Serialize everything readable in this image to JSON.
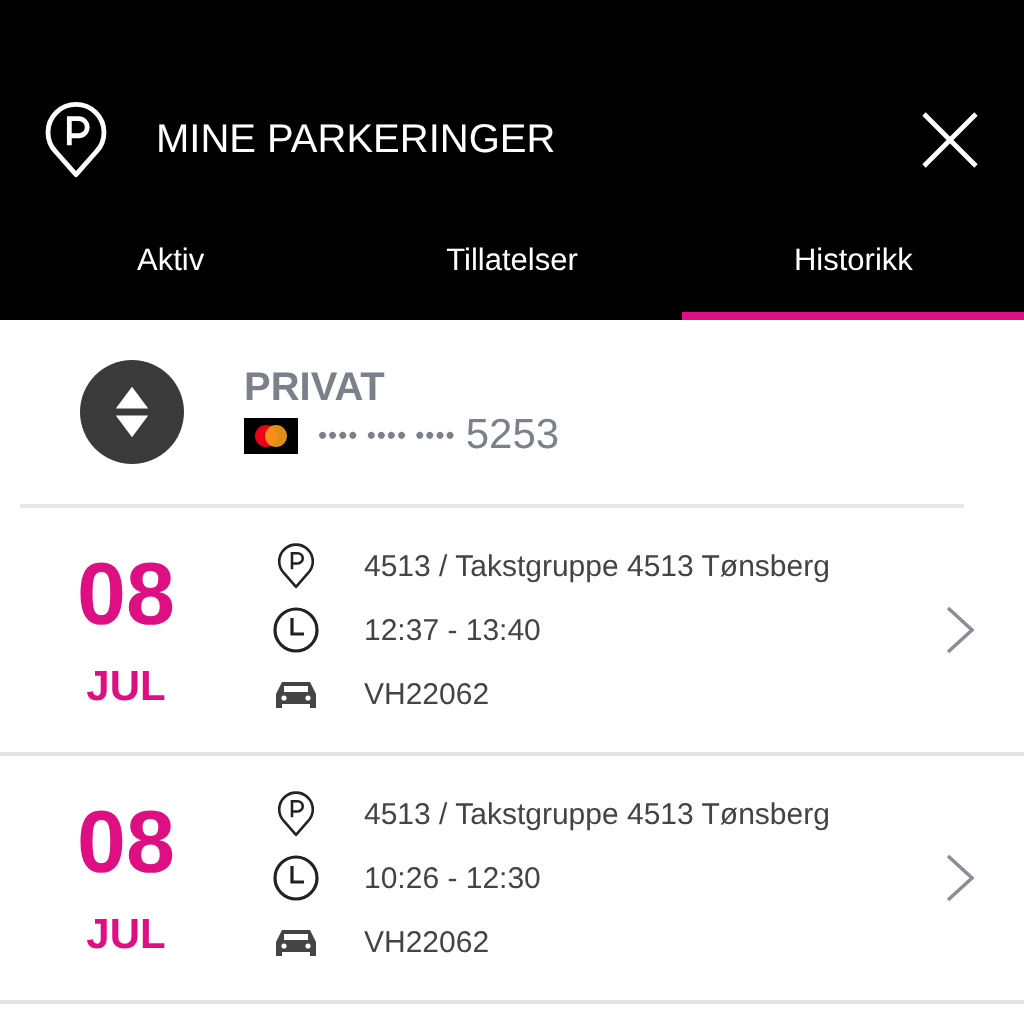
{
  "header": {
    "title": "MINE PARKERINGER"
  },
  "tabs": [
    {
      "label": "Aktiv",
      "selected": false
    },
    {
      "label": "Tillatelser",
      "selected": false
    },
    {
      "label": "Historikk",
      "selected": true
    }
  ],
  "account": {
    "name": "PRIVAT",
    "card_mask": "•••• •••• ••••",
    "card_last": "5253"
  },
  "parkings": [
    {
      "day": "08",
      "month": "JUL",
      "zone": "4513 / Takstgruppe 4513 Tønsberg",
      "time": "12:37 - 13:40",
      "plate": "VH22062"
    },
    {
      "day": "08",
      "month": "JUL",
      "zone": "4513 / Takstgruppe 4513 Tønsberg",
      "time": "10:26 - 12:30",
      "plate": "VH22062"
    }
  ]
}
